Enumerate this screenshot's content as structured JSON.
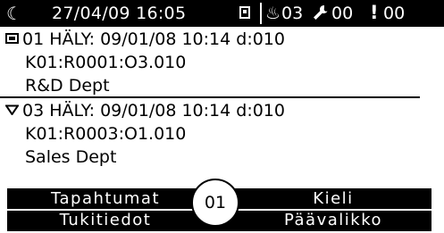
{
  "status_bar": {
    "datetime": "27/04/09 16:05",
    "fire_count": "03",
    "fault_count": "00",
    "alert_count": "00",
    "icons": [
      "moon-icon",
      "panel-icon",
      "fire-icon",
      "wrench-icon",
      "exclamation-icon"
    ]
  },
  "alarms": [
    {
      "icon": "panel-icon",
      "line1": "01 HÄLY: 09/01/08 10:14 d:010",
      "line2": "K01:R0001:O3.010",
      "line3": "R&D Dept"
    },
    {
      "icon": "triangle-icon",
      "line1": "03 HÄLY: 09/01/08 10:14 d:010",
      "line2": "K01:R0003:O1.010",
      "line3": "Sales Dept"
    }
  ],
  "softkeys": {
    "top_left": "Tapahtumat",
    "bottom_left": "Tukitiedot",
    "top_right": "Kieli",
    "bottom_right": "Päävalikko",
    "center_badge": "01"
  },
  "colors": {
    "foreground": "#000000",
    "background": "#ffffff"
  }
}
